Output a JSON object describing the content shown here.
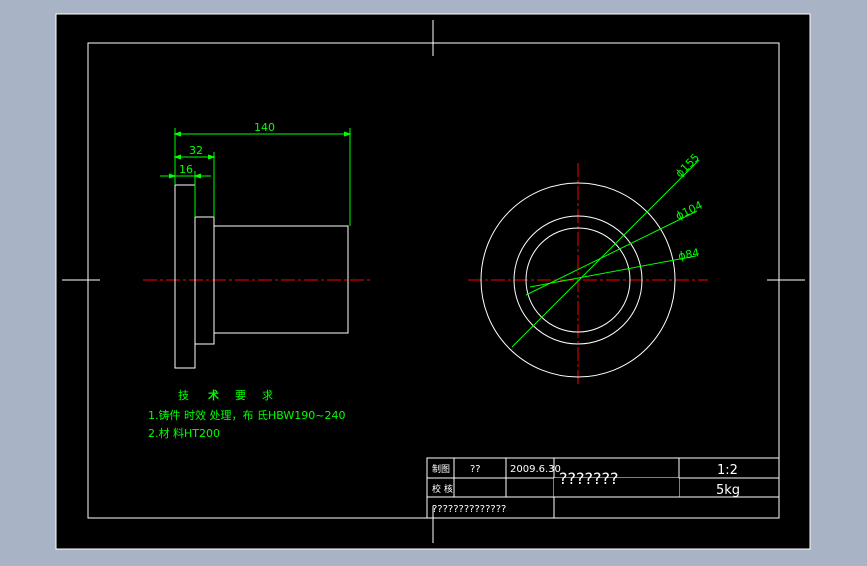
{
  "drawing": {
    "dimensions": {
      "length": "140",
      "flange_step": "32",
      "flange_thickness": "16",
      "dia_outer": "ϕ155",
      "dia_middle": "ϕ104",
      "dia_inner": "ϕ84"
    },
    "tech_requirements": {
      "title_chars": [
        "技",
        "术",
        "要",
        "求"
      ],
      "item1": "1.铸件 时效 处理，布 氏HBW190~240",
      "item2": "2.材 料HT200"
    },
    "title_block": {
      "drawn_label": "制图",
      "drawn_value": "??",
      "date": "2009.6.30",
      "name": "???????",
      "scale": "1:2",
      "weight": "5kg",
      "check_label": "校 核",
      "company": "??????????????"
    }
  },
  "colors": {
    "background": "#a9b3c6",
    "canvas": "#000000",
    "geometry": "#ffffff",
    "dimension": "#00ff00",
    "centerline": "#ff0000"
  }
}
